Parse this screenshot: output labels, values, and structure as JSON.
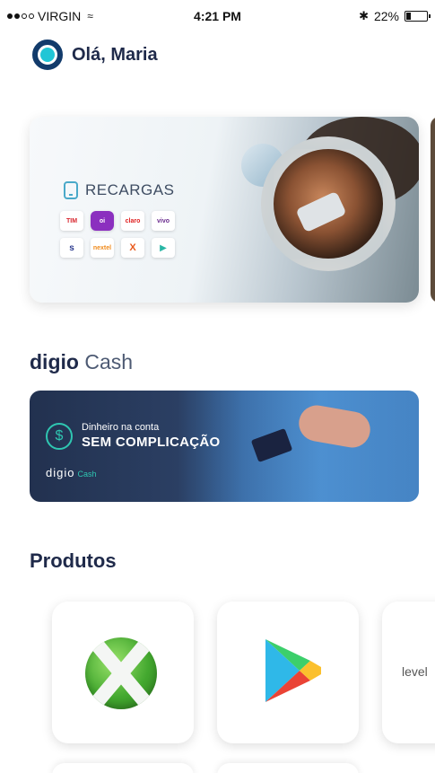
{
  "status_bar": {
    "carrier": "VIRGIN",
    "wifi_icon": "wifi-icon",
    "time": "4:21 PM",
    "bluetooth_icon": "bluetooth-icon",
    "battery_percent": "22%",
    "battery_level": 0.22
  },
  "header": {
    "logo_icon": "digio-logo",
    "greeting": "Olá, Maria"
  },
  "banner_recargas": {
    "title": "RECARGAS",
    "operators": [
      "TIM",
      "oi",
      "claro",
      "vivo",
      "s",
      "nextel",
      "X",
      "▶"
    ]
  },
  "digio_cash": {
    "title_bold": "digio",
    "title_light": "Cash",
    "banner_small": "Dinheiro na conta",
    "banner_big": "SEM COMPLICAÇÃO",
    "banner_logo": "digio",
    "banner_logo_accent": "Cash",
    "icon": "dollar-icon"
  },
  "produtos": {
    "title": "Produtos",
    "items": [
      {
        "name": "Xbox",
        "icon": "xbox-icon"
      },
      {
        "name": "Google Play",
        "icon": "google-play-icon"
      },
      {
        "name": "level",
        "label": "level"
      }
    ]
  },
  "colors": {
    "navy": "#1f2a4a",
    "teal": "#21c6d6",
    "cash_accent": "#2fc6b1"
  }
}
